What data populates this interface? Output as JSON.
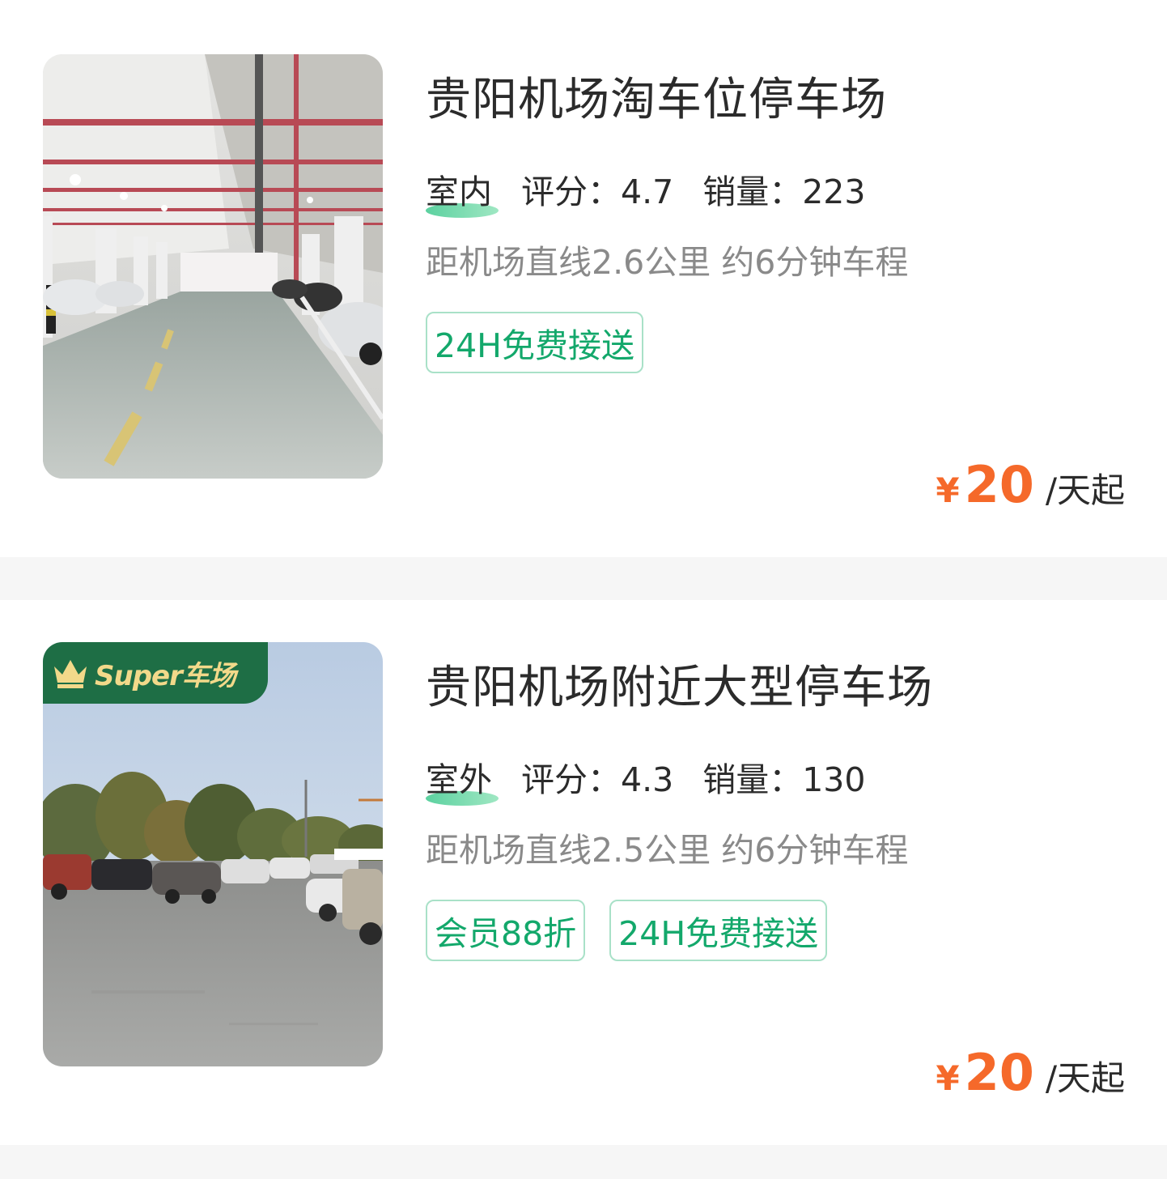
{
  "listings": [
    {
      "title": "贵阳机场淘车位停车场",
      "type": "室内",
      "score": "评分：4.7",
      "sales": "销量：223",
      "distance": "距机场直线2.6公里 约6分钟车程",
      "tags": [
        "24H免费接送"
      ],
      "price_symbol": "¥",
      "price": "20",
      "price_unit": "/天起",
      "image": "indoor-parking-garage-photo"
    },
    {
      "title": "贵阳机场附近大型停车场",
      "type": "室外",
      "score": "评分：4.3",
      "sales": "销量：130",
      "distance": "距机场直线2.5公里 约6分钟车程",
      "tags": [
        "会员88折",
        "24H免费接送"
      ],
      "price_symbol": "¥",
      "price": "20",
      "price_unit": "/天起",
      "image": "outdoor-parking-lot-photo",
      "badge": "Super车场"
    }
  ],
  "colors": {
    "accent_green": "#13a86b",
    "price_orange": "#f5692a",
    "badge_green": "#1e6e45",
    "badge_text": "#f2d98a"
  }
}
